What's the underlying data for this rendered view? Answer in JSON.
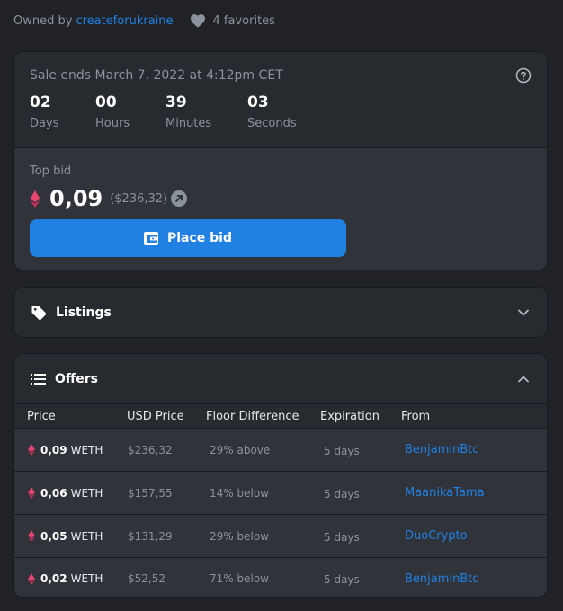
{
  "owner": {
    "prefix": "Owned by",
    "name": "createforukraine"
  },
  "favorites": {
    "label": "4 favorites"
  },
  "sale": {
    "ends": "Sale ends March 7, 2022 at 4:12pm CET",
    "timer": [
      {
        "value": "02",
        "label": "Days"
      },
      {
        "value": "00",
        "label": "Hours"
      },
      {
        "value": "39",
        "label": "Minutes"
      },
      {
        "value": "03",
        "label": "Seconds"
      }
    ]
  },
  "bid": {
    "label": "Top bid",
    "amount": "0,09",
    "usd": "($236,32)",
    "button": "Place bid"
  },
  "listings": {
    "title": "Listings"
  },
  "offers": {
    "title": "Offers",
    "columns": [
      "Price",
      "USD Price",
      "Floor Difference",
      "Expiration",
      "From"
    ],
    "rows": [
      {
        "price": "0,09",
        "currency": "WETH",
        "usd": "$236,32",
        "floor": "29% above",
        "expiration": "5 days",
        "from": "BenjaminBtc"
      },
      {
        "price": "0,06",
        "currency": "WETH",
        "usd": "$157,55",
        "floor": "14% below",
        "expiration": "5 days",
        "from": "MaanikaTama"
      },
      {
        "price": "0,05",
        "currency": "WETH",
        "usd": "$131,29",
        "floor": "29% below",
        "expiration": "5 days",
        "from": "DuoCrypto"
      },
      {
        "price": "0,02",
        "currency": "WETH",
        "usd": "$52,52",
        "floor": "71% below",
        "expiration": "5 days",
        "from": "BenjaminBtc"
      }
    ]
  },
  "colors": {
    "accent": "#2081e2",
    "eth": "#e8446f"
  },
  "icons": [
    "heart-icon",
    "help-icon",
    "eth-icon",
    "external-arrow-icon",
    "wallet-icon",
    "tag-icon",
    "list-icon",
    "chevron-down-icon",
    "chevron-up-icon"
  ]
}
